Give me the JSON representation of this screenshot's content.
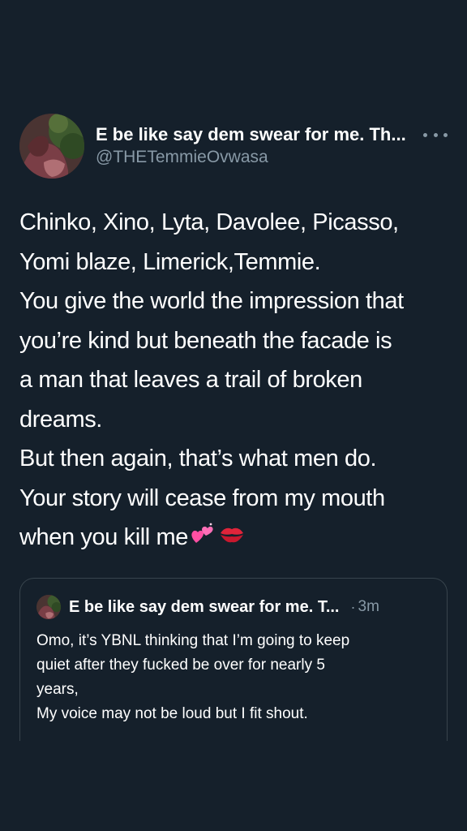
{
  "colors": {
    "background": "#15202b",
    "text_primary": "#ffffff",
    "text_secondary": "#8899a6",
    "border": "#38444d"
  },
  "tweet": {
    "display_name": "E be like say dem swear for me. Th...",
    "handle": "@THETemmieOvwasa",
    "more_icon": "more-horizontal-icon",
    "body_lines": [
      "Chinko, Xino, Lyta, Davolee, Picasso,",
      "Yomi blaze, Limerick,Temmie.",
      "You give the world the impression that",
      "you’re kind but beneath the facade is",
      "a man that leaves a trail of broken",
      "dreams.",
      "But then again, that’s what men do.",
      "Your story will cease from my mouth",
      "when you kill me"
    ],
    "emojis": [
      "two-hearts-emoji",
      "kiss-mark-emoji"
    ]
  },
  "quote": {
    "display_name": "E be like say dem swear for me. T...",
    "separator": "·",
    "time": "3m",
    "text_lines": [
      "Omo, it’s YBNL thinking that I’m going to keep",
      "quiet after they fucked be over for nearly 5",
      "years,",
      "My voice may not be loud but I fit shout."
    ]
  }
}
